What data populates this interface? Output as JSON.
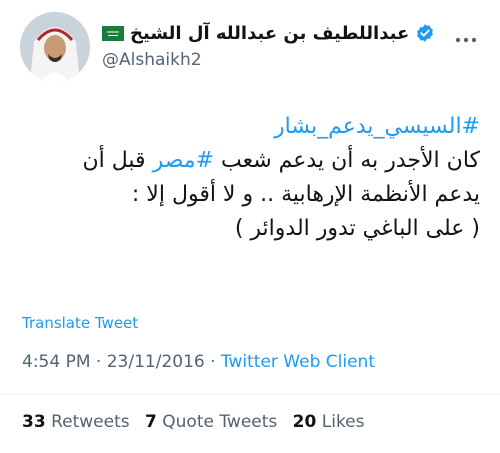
{
  "author": {
    "display_name": "عبداللطيف بن عبدالله آل الشيخ",
    "handle": "@Alshaikh2"
  },
  "tweet": {
    "hashtag_line": "#السيسي_يدعم_بشار",
    "line2_pre": "كان الأجدر به أن يدعم شعب ",
    "line2_hashtag": "#مصر",
    "line2_post": " قبل أن",
    "line3": "يدعم الأنظمة الإرهابية .. و لا أقول إلا :",
    "line4": "( على الباغي تدور الدوائر )"
  },
  "translate_label": "Translate Tweet",
  "meta": {
    "time": "4:54 PM",
    "sep1": " · ",
    "date": "23/11/2016",
    "sep2": " · ",
    "client": "Twitter Web Client"
  },
  "stats": {
    "retweets_count": "33",
    "retweets_label": "Retweets",
    "quotes_count": "7",
    "quotes_label": "Quote Tweets",
    "likes_count": "20",
    "likes_label": "Likes"
  },
  "icons": {
    "verified": "verified-badge-icon",
    "flag": "saudi-flag-icon",
    "more": "more-options-icon"
  },
  "colors": {
    "accent": "#1d9bf0",
    "text": "#0f1419",
    "muted": "#536471"
  }
}
